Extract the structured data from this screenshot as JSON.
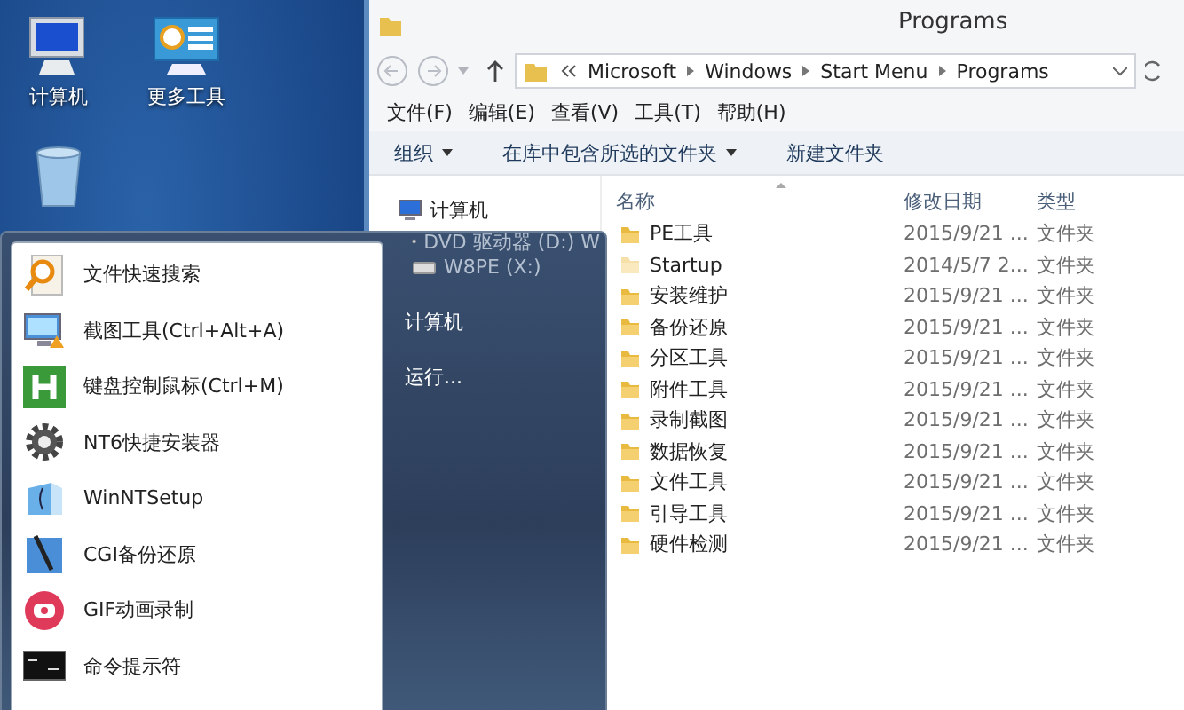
{
  "desktop": {
    "icons": [
      {
        "kind": "computer",
        "label": "计算机"
      },
      {
        "kind": "tools",
        "label": "更多工具"
      },
      {
        "kind": "recycle"
      }
    ]
  },
  "explorer": {
    "title": "Programs",
    "address": {
      "segments": [
        "Microsoft",
        "Windows",
        "Start Menu",
        "Programs"
      ]
    },
    "menu": [
      "文件(F)",
      "编辑(E)",
      "查看(V)",
      "工具(T)",
      "帮助(H)"
    ],
    "toolbar": [
      {
        "label": "组织",
        "dropdown": true
      },
      {
        "label": "在库中包含所选的文件夹",
        "dropdown": true
      },
      {
        "label": "新建文件夹",
        "dropdown": false
      }
    ],
    "nav": [
      {
        "kind": "computer",
        "label": "计算机"
      },
      {
        "kind": "dvd",
        "label": "DVD 驱动器 (D:) W"
      },
      {
        "kind": "drive",
        "label": "W8PE (X:)"
      }
    ],
    "columns": [
      "名称",
      "修改日期",
      "类型"
    ],
    "rows": [
      {
        "name": "PE工具",
        "modified": "2015/9/21 ...",
        "type": "文件夹",
        "hidden": false
      },
      {
        "name": "Startup",
        "modified": "2014/5/7 2...",
        "type": "文件夹",
        "hidden": true
      },
      {
        "name": "安装维护",
        "modified": "2015/9/21 ...",
        "type": "文件夹",
        "hidden": false
      },
      {
        "name": "备份还原",
        "modified": "2015/9/21 ...",
        "type": "文件夹",
        "hidden": false
      },
      {
        "name": "分区工具",
        "modified": "2015/9/21 ...",
        "type": "文件夹",
        "hidden": false
      },
      {
        "name": "附件工具",
        "modified": "2015/9/21 ...",
        "type": "文件夹",
        "hidden": false
      },
      {
        "name": "录制截图",
        "modified": "2015/9/21 ...",
        "type": "文件夹",
        "hidden": false
      },
      {
        "name": "数据恢复",
        "modified": "2015/9/21 ...",
        "type": "文件夹",
        "hidden": false
      },
      {
        "name": "文件工具",
        "modified": "2015/9/21 ...",
        "type": "文件夹",
        "hidden": false
      },
      {
        "name": "引导工具",
        "modified": "2015/9/21 ...",
        "type": "文件夹",
        "hidden": false
      },
      {
        "name": "硬件检测",
        "modified": "2015/9/21 ...",
        "type": "文件夹",
        "hidden": false
      }
    ]
  },
  "start_menu": {
    "programs": [
      {
        "kind": "search",
        "label": "文件快速搜索"
      },
      {
        "kind": "screenshot",
        "label": "截图工具(Ctrl+Alt+A)"
      },
      {
        "kind": "keyboard",
        "label": "键盘控制鼠标(Ctrl+M)"
      },
      {
        "kind": "gear",
        "label": "NT6快捷安装器"
      },
      {
        "kind": "setup",
        "label": "WinNTSetup"
      },
      {
        "kind": "backup",
        "label": "CGI备份还原"
      },
      {
        "kind": "record",
        "label": "GIF动画录制"
      },
      {
        "kind": "console",
        "label": "命令提示符"
      }
    ],
    "places": [
      "计算机",
      "运行..."
    ]
  }
}
